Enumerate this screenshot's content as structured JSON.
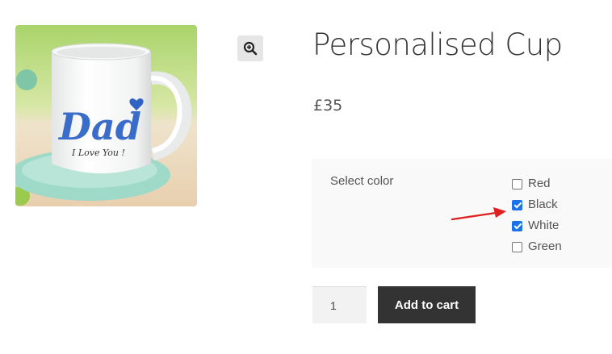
{
  "product": {
    "title": "Personalised Cup",
    "price": "£35",
    "image": {
      "mug_text_large": "Dad",
      "mug_text_small": "I Love You !"
    }
  },
  "zoom": {
    "icon": "zoom-in-icon"
  },
  "variations": {
    "label": "Select color",
    "options": [
      {
        "label": "Red",
        "checked": false
      },
      {
        "label": "Black",
        "checked": true
      },
      {
        "label": "White",
        "checked": true
      },
      {
        "label": "Green",
        "checked": false
      }
    ]
  },
  "annotation": {
    "icon": "red-arrow-icon",
    "color": "#e02020"
  },
  "cart": {
    "quantity": "1",
    "button_label": "Add to cart"
  },
  "colors": {
    "button_bg": "#333333",
    "checkbox_checked": "#1a73e8",
    "panel_bg": "#f9f9f9"
  }
}
